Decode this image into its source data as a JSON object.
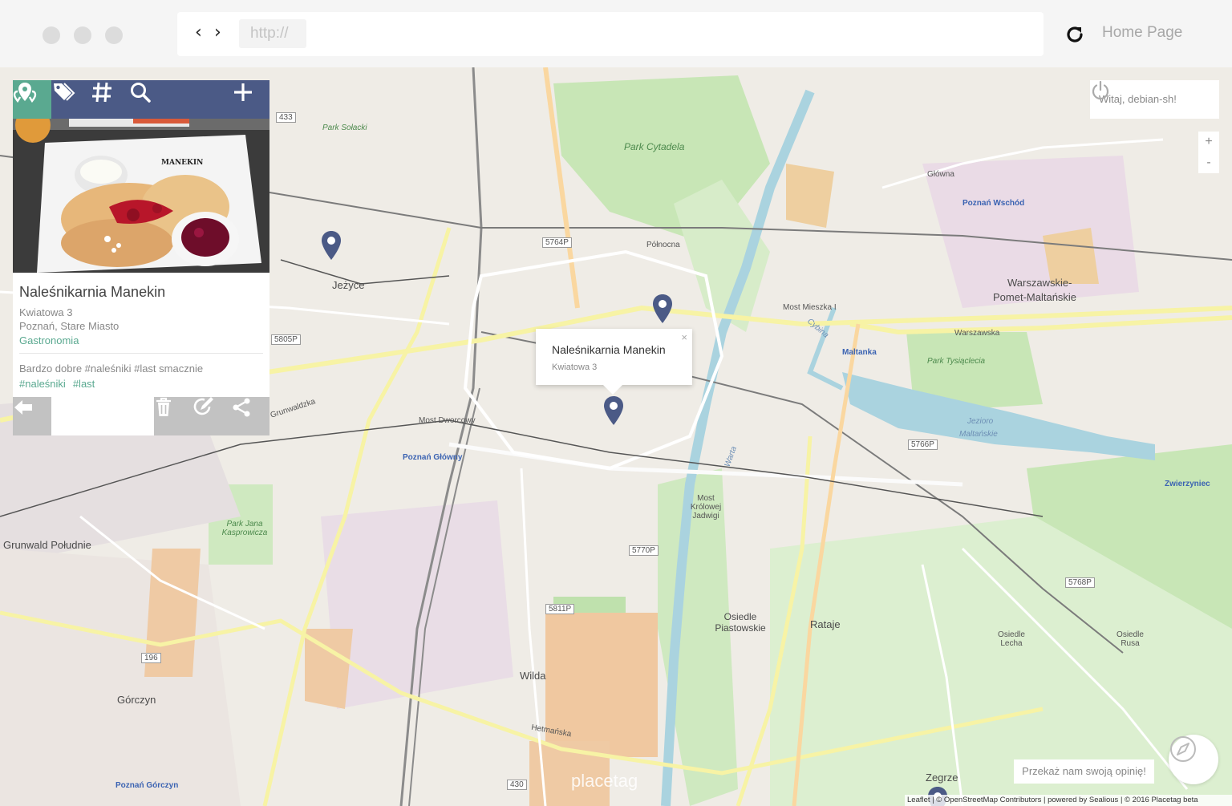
{
  "browser": {
    "back_glyph": "‹",
    "forward_glyph": "›",
    "url_placeholder": "http://",
    "home_label": "Home Page"
  },
  "toolbar": {
    "icons": [
      "places-icon",
      "tags-icon",
      "hashtag-icon",
      "search-icon",
      "add-icon"
    ]
  },
  "place": {
    "name": "Naleśnikarnia Manekin",
    "street": "Kwiatowa 3",
    "city": "Poznań, Stare Miasto",
    "category": "Gastronomia",
    "description": "Bardzo dobre #naleśniki #last smacznie",
    "tags": [
      "#naleśniki",
      "#last"
    ],
    "photo_sign": "MANEKIN"
  },
  "popup": {
    "title": "Naleśnikarnia Manekin",
    "address": "Kwiatowa 3",
    "close": "×"
  },
  "user": {
    "greeting": "Witaj, debian-sh!"
  },
  "zoom": {
    "in": "+",
    "out": "-"
  },
  "feedback_label": "Przekaż nam swoją opinię!",
  "watermark": "placetag",
  "attribution": "Leaflet | © OpenStreetMap Contributors | powered by Sealious | © 2016 Placetag beta",
  "map_labels": {
    "jezyce": "Jeżyce",
    "park_solacki": "Park Sołacki",
    "park_cytadela": "Park Cytadela",
    "poznan_wschod": "Poznań Wschód",
    "warszawskie": "Warszawskie-",
    "pomet": "Pomet-Maltańskie",
    "maltanka": "Maltanka",
    "park_tysiaclecia": "Park Tysiąclecia",
    "jezioro": "Jezioro",
    "maltanskie": "Maltańskie",
    "zwierzyniec": "Zwierzyniec",
    "poznan_glowny": "Poznań Główny",
    "grunwald": "Grunwald Południe",
    "park_kasprowicza": "Park Jana Kasprowicza",
    "wilda": "Wilda",
    "gorczyn": "Górczyn",
    "poznan_gorczyn": "Poznań Górczyn",
    "osiedle_piastowskie": "Osiedle Piastowskie",
    "rataje": "Rataje",
    "zegrze": "Zegrze",
    "polnocna": "Północna",
    "warszawska": "Warszawska",
    "grunwaldzka": "Grunwaldzka",
    "hetmanska": "Hetmańska",
    "glowna": "Główna",
    "road_5764p": "5764P",
    "road_5805p": "5805P",
    "road_5770p": "5770P",
    "road_5811p": "5811P",
    "road_5766p": "5766P",
    "road_5768p": "5768P",
    "road_433": "433",
    "road_196": "196",
    "road_430": "430",
    "most_dworcowy": "Most Dworcowy",
    "most_krolowej": "Most Królowej Jadwigi",
    "most_mieszka": "Most Mieszka I",
    "osiedle_rusa": "Osiedle Rusa",
    "osiedle_lecha": "Osiedle Lecha",
    "warta": "Warta",
    "cybina": "Cybina"
  }
}
